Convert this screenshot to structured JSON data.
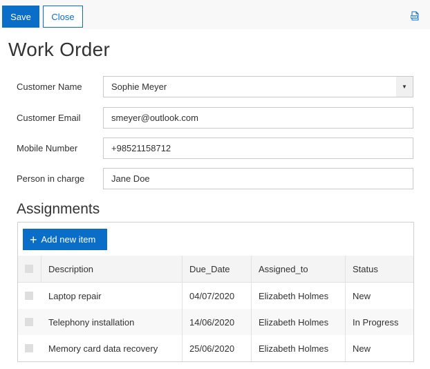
{
  "toolbar": {
    "save_label": "Save",
    "close_label": "Close",
    "pdf_icon": "pdf-export-icon",
    "accent": "#0a6ec9"
  },
  "page": {
    "title": "Work Order"
  },
  "form": {
    "customer_name_label": "Customer Name",
    "customer_name_value": "Sophie Meyer",
    "customer_email_label": "Customer Email",
    "customer_email_value": "smeyer@outlook.com",
    "mobile_label": "Mobile Number",
    "mobile_value": "+98521158712",
    "person_label": "Person in charge",
    "person_value": "Jane Doe"
  },
  "assignments": {
    "title": "Assignments",
    "add_label": "Add new item",
    "columns": [
      "Description",
      "Due_Date",
      "Assigned_to",
      "Status"
    ],
    "rows": [
      [
        "Laptop repair",
        "04/07/2020",
        "Elizabeth Holmes",
        "New"
      ],
      [
        "Telephony installation",
        "14/06/2020",
        "Elizabeth Holmes",
        "In Progress"
      ],
      [
        "Memory card data recovery",
        "25/06/2020",
        "Elizabeth Holmes",
        "New"
      ]
    ]
  }
}
